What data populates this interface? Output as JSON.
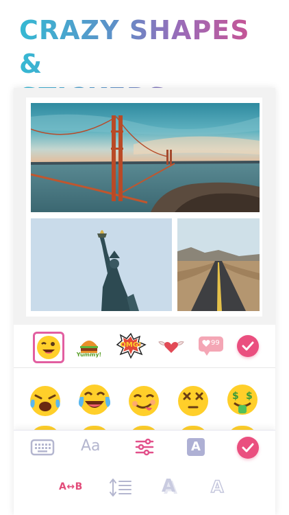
{
  "headline": {
    "line1": "CRAZY SHAPES &",
    "line2": "STICKERS"
  },
  "collage": {
    "photos": [
      {
        "subject": "golden-gate-bridge"
      },
      {
        "subject": "statue-of-liberty"
      },
      {
        "subject": "desert-road"
      }
    ]
  },
  "sticker_bar": {
    "items": [
      "wink-face-sticker",
      "yummy-burger-sticker",
      "omg-sticker",
      "winged-heart-sticker",
      "like-99-sticker"
    ],
    "sticker_texts": {
      "yummy": "Yummy!",
      "omg": "OMG!",
      "likes": "99"
    },
    "confirm_icon": "check-icon"
  },
  "emoji_tray": {
    "row1": [
      "crying-face",
      "tears-of-joy-face",
      "yum-face",
      "dizzy-face",
      "money-mouth-face"
    ]
  },
  "toolbar": {
    "font_label": "Aa",
    "text_color_label": "A",
    "tools": [
      "keyboard-icon",
      "font-tool",
      "adjust-sliders-icon",
      "text-color-icon",
      "check-icon"
    ]
  },
  "text_options": {
    "letter_spacing_label": "A↔B",
    "tools": [
      "letter-spacing",
      "line-spacing-icon",
      "text-shadow",
      "text-outline"
    ],
    "shadow_label": "A",
    "outline_label": "A"
  },
  "colors": {
    "accent": "#ea4f7f",
    "icon_muted": "#b4b6cf",
    "headline_gradient": [
      "#35b9d3",
      "#9a6bb8",
      "#d94b86"
    ]
  }
}
